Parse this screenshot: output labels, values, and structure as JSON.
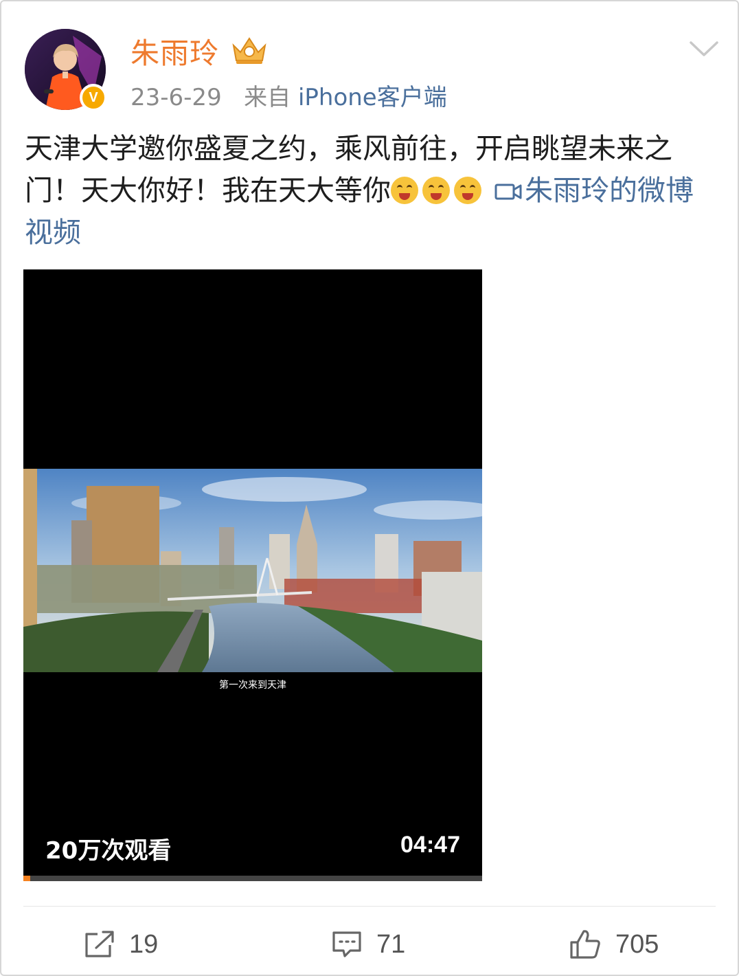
{
  "author": {
    "name": "朱雨玲",
    "verified_badge": "V",
    "crown_icon": "vip-crown-icon",
    "avatar_icon": "avatar-image"
  },
  "meta": {
    "date": "23-6-29",
    "source_prefix": "来自",
    "source": "iPhone客户端"
  },
  "post": {
    "text": "天津大学邀你盛夏之约，乘风前往，开启眺望未来之门！天大你好！我在天大等你",
    "emoji_count": 3,
    "emoji_icon": "crying-laughing-emoji-icon",
    "video_link": "朱雨玲的微博视频"
  },
  "video": {
    "subtitle": "第一次来到天津",
    "views": "20万次观看",
    "duration": "04:47",
    "progress_fraction": 0.015
  },
  "actions": {
    "share_count": "19",
    "comment_count": "71",
    "like_count": "705"
  },
  "colors": {
    "username": "#ee7a2e",
    "link": "#4a6f9c",
    "badge": "#f7a900",
    "progress": "#f58220"
  }
}
